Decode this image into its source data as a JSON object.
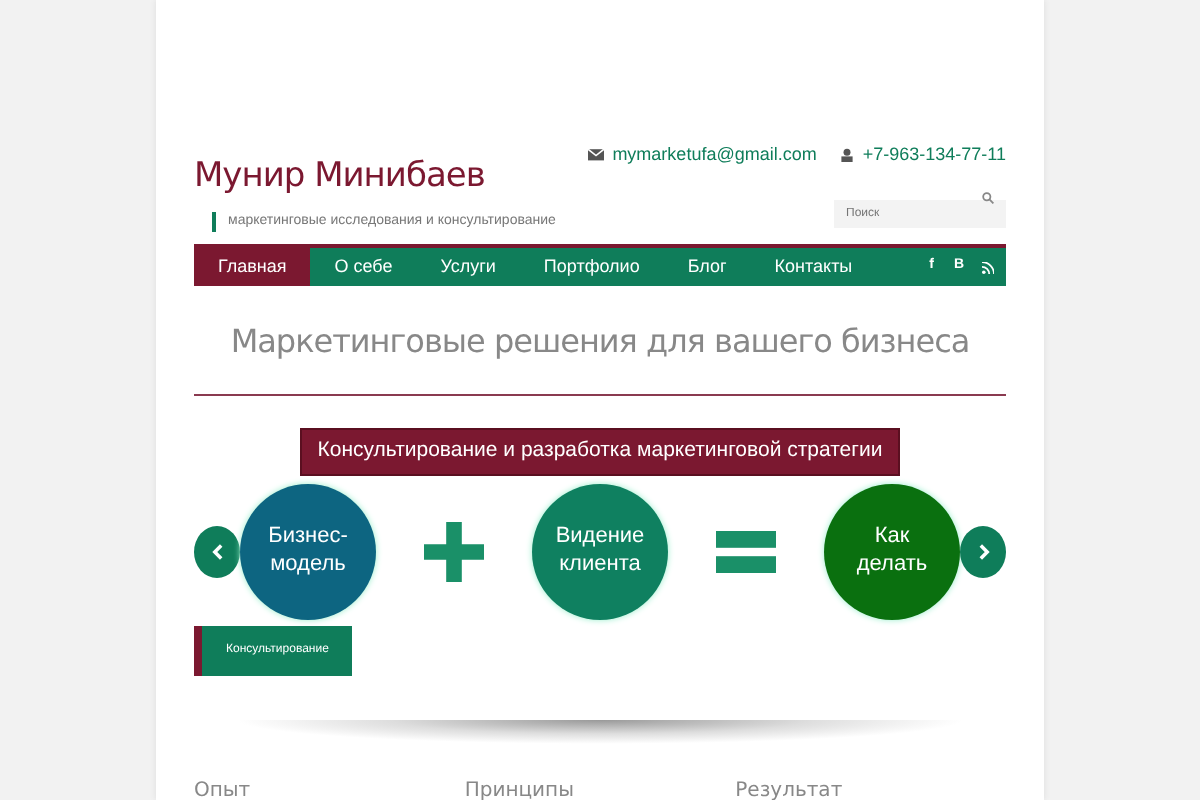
{
  "site": {
    "title": "Мунир Минибаев",
    "tagline": "маркетинговые исследования и консультирование",
    "email": "mymarketufa@gmail.com",
    "phone": "+7-963-134-77-11"
  },
  "search": {
    "placeholder": "Поиск"
  },
  "nav": [
    {
      "label": "Главная",
      "selected": true
    },
    {
      "label": "О себе",
      "selected": false
    },
    {
      "label": "Услуги",
      "selected": false
    },
    {
      "label": "Портфолио",
      "selected": false
    },
    {
      "label": "Блог",
      "selected": false
    },
    {
      "label": "Контакты",
      "selected": false
    }
  ],
  "social": [
    "f",
    "B"
  ],
  "headline": "Маркетинговые решения для вашего бизнеса",
  "slide": {
    "banner": "Консультирование и разработка маркетинговой стратегии",
    "items": [
      {
        "kind": "circle",
        "text": "Бизнес-\nмодель",
        "color": "#0d6581"
      },
      {
        "kind": "plus"
      },
      {
        "kind": "circle",
        "text": "Видение\nклиента",
        "color": "#0f8060"
      },
      {
        "kind": "equals"
      },
      {
        "kind": "circle",
        "text": "Как\nделать",
        "color": "#0a700f"
      }
    ],
    "caption": "Консультирование"
  },
  "columns": [
    {
      "title": "Опыт"
    },
    {
      "title": "Принципы"
    },
    {
      "title": "Результат"
    }
  ]
}
